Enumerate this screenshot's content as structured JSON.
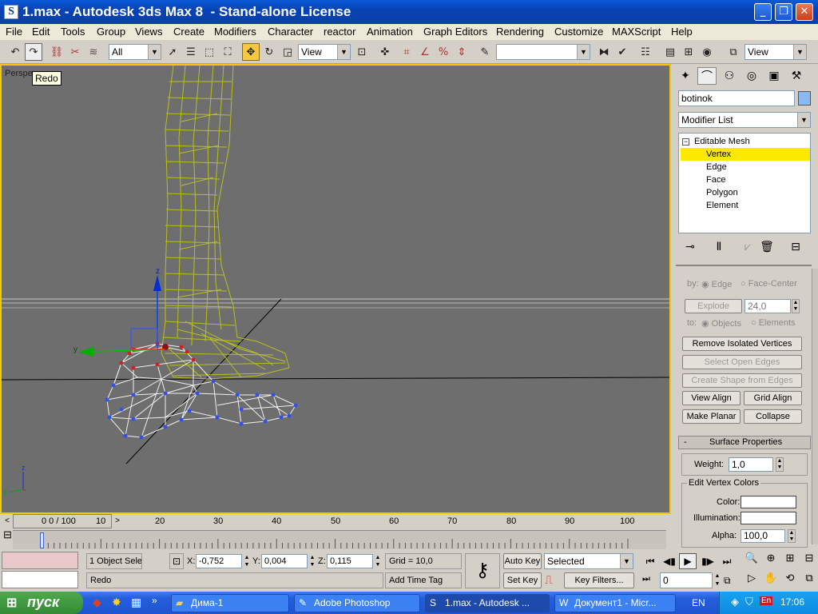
{
  "window": {
    "title": "1.max - Autodesk 3ds Max 8  - Stand-alone License",
    "app_icon": "3ds-max-icon",
    "controls": [
      "minimize-icon",
      "maximize-icon",
      "close-icon"
    ]
  },
  "menu": [
    "File",
    "Edit",
    "Tools",
    "Group",
    "Views",
    "Create",
    "Modifiers",
    "Character",
    "reactor",
    "Animation",
    "Graph Editors",
    "Rendering",
    "Customize",
    "MAXScript",
    "Help"
  ],
  "toolbar": {
    "selection_filter": "All",
    "ref_coord_system": "View",
    "named_selection": "",
    "view_dropdown": "View",
    "tooltip": "Redo"
  },
  "viewport": {
    "label": "Perspe",
    "axis_labels": {
      "x": "x",
      "y": "y",
      "z": "z"
    }
  },
  "command_panel": {
    "object_name": "botinok",
    "object_color": "#8ab8f0",
    "modifier_list": "Modifier List",
    "stack": [
      {
        "label": "Editable Mesh",
        "level": 0
      },
      {
        "label": "Vertex",
        "level": 1,
        "selected": true
      },
      {
        "label": "Edge",
        "level": 1
      },
      {
        "label": "Face",
        "level": 1
      },
      {
        "label": "Polygon",
        "level": 1
      },
      {
        "label": "Element",
        "level": 1
      }
    ],
    "rollout": {
      "by_label": "by:",
      "by_edge": "Edge",
      "by_face_center": "Face-Center",
      "explode_button": "Explode",
      "explode_value": "24,0",
      "to_label": "to:",
      "to_objects": "Objects",
      "to_elements": "Elements",
      "remove_isolated": "Remove Isolated Vertices",
      "select_open_edges": "Select Open Edges",
      "create_shape": "Create Shape from Edges",
      "view_align": "View Align",
      "grid_align": "Grid Align",
      "make_planar": "Make Planar",
      "collapse": "Collapse"
    },
    "surface_properties": {
      "header_sign": "-",
      "header": "Surface Properties",
      "weight_label": "Weight:",
      "weight_value": "1,0",
      "vertex_colors_group": "Edit Vertex Colors",
      "color_label": "Color:",
      "illumination_label": "Illumination:",
      "alpha_label": "Alpha:",
      "alpha_value": "100,0"
    }
  },
  "timeline": {
    "frame_display": "0 / 100",
    "ticks": [
      "0",
      "10",
      "20",
      "30",
      "40",
      "50",
      "60",
      "70",
      "80",
      "90",
      "100"
    ]
  },
  "status": {
    "selection_info": "1 Object Sele",
    "x_label": "X:",
    "x_value": "-0,752",
    "y_label": "Y:",
    "y_value": "0,004",
    "z_label": "Z:",
    "z_value": "0,115",
    "grid": "Grid = 10,0",
    "prompt": "Redo",
    "add_time_tag": "Add Time Tag",
    "auto_key": "Auto Key",
    "set_key": "Set Key",
    "selected_dropdown": "Selected",
    "key_filters": "Key Filters...",
    "current_frame": "0"
  },
  "taskbar": {
    "start": "пуск",
    "tasks": [
      {
        "label": "Дима-1",
        "icon": "folder-icon",
        "active": false
      },
      {
        "label": "Adobe Photoshop",
        "icon": "photoshop-icon",
        "active": false
      },
      {
        "label": "1.max - Autodesk ...",
        "icon": "3ds-max-icon",
        "active": true
      },
      {
        "label": "Документ1 - Micr...",
        "icon": "word-icon",
        "active": false
      }
    ],
    "language": "EN",
    "lang_badge": "En",
    "clock": "17:06"
  }
}
